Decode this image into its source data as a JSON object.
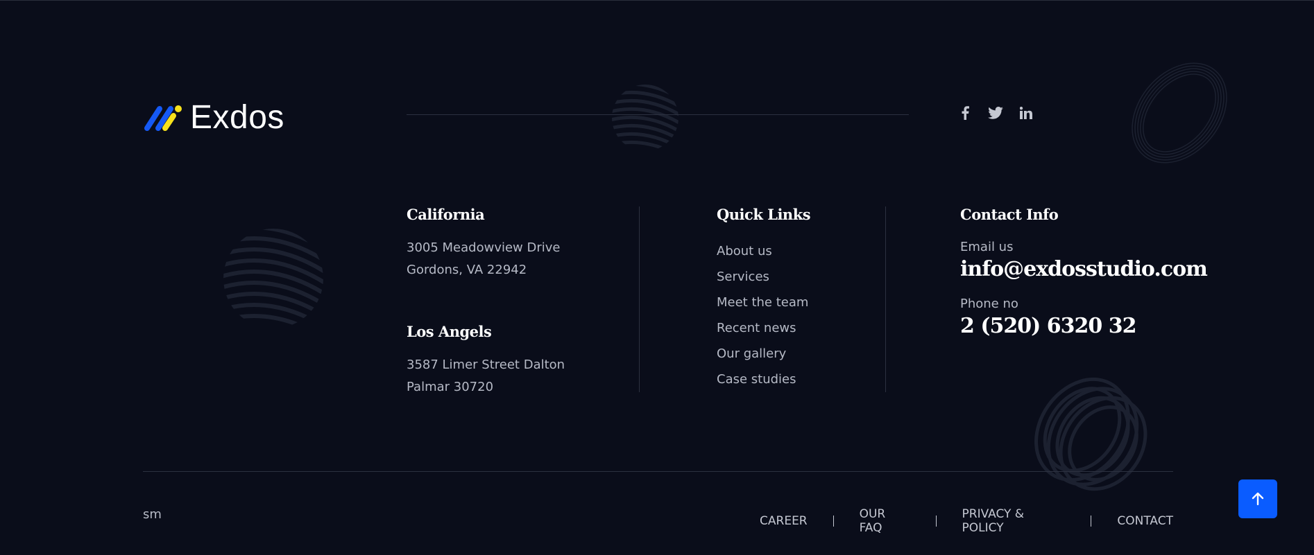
{
  "brand": {
    "name": "Exdos",
    "accent_blue": "#1559f5",
    "accent_yellow": "#f7e11c"
  },
  "social": [
    {
      "icon": "facebook-icon"
    },
    {
      "icon": "twitter-icon"
    },
    {
      "icon": "linkedin-icon"
    }
  ],
  "locations": {
    "california": {
      "title": "California",
      "line1": "3005 Meadowview Drive",
      "line2": "Gordons, VA 22942"
    },
    "los_angels": {
      "title": "Los Angels",
      "line1": "3587 Limer Street Dalton",
      "line2": "Palmar 30720"
    }
  },
  "quick_links": {
    "title": "Quick Links",
    "items": [
      "About us",
      "Services",
      "Meet the team",
      "Recent news",
      "Our gallery",
      "Case studies"
    ]
  },
  "contact": {
    "title": "Contact Info",
    "email_label": "Email us",
    "email": "info@exdosstudio.com",
    "phone_label": "Phone no",
    "phone": "2 (520) 6320 32"
  },
  "footer": {
    "copyright": "sm",
    "links": [
      "CAREER",
      "OUR FAQ",
      "PRIVACY & POLICY",
      "CONTACT"
    ]
  },
  "back_to_top": {
    "icon": "arrow-up-icon",
    "color": "#0a5cff"
  }
}
